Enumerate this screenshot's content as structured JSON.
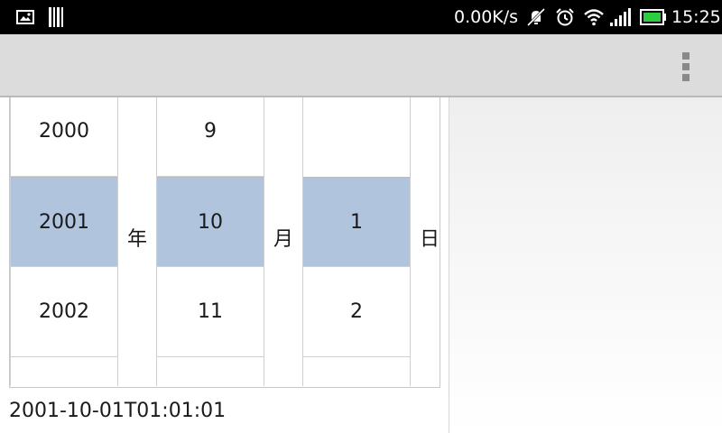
{
  "status_bar": {
    "network_speed": "0.00K/s",
    "time": "15:25",
    "icons": [
      "image-notification-icon",
      "barcode-notification-icon",
      "mute-vibrate-icon",
      "alarm-clock-icon",
      "wifi-icon",
      "signal-strength-icon",
      "battery-icon"
    ],
    "battery_color": "#2ecc40"
  },
  "action_bar": {
    "overflow_icon": "overflow-menu-icon"
  },
  "date_picker": {
    "selection_color": "#b0c4de",
    "year": {
      "items": [
        "2000",
        "2001",
        "2002",
        ""
      ],
      "selected": "2001",
      "unit": "年"
    },
    "month": {
      "items": [
        "9",
        "10",
        "11",
        ""
      ],
      "selected": "10",
      "unit": "月"
    },
    "day": {
      "items": [
        "1",
        "2",
        ""
      ],
      "selected": "1",
      "unit": "日"
    }
  },
  "result": {
    "datetime": "2001-10-01T01:01:01"
  }
}
